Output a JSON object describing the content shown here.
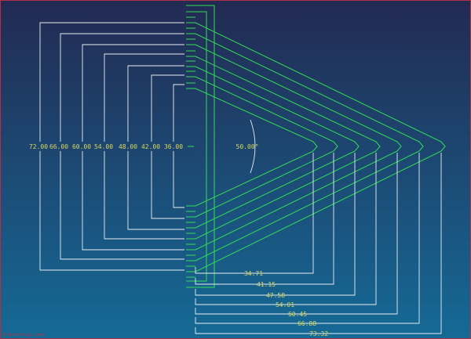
{
  "viewport": {
    "status_text": "Intersecting Lines",
    "colors": {
      "background_top": "#222a52",
      "background_bottom": "#156a96",
      "border": "#b0304a",
      "chevron_stroke": "#33dd55",
      "dimension_stroke": "#e8eef3",
      "dimension_text": "#d8d860",
      "status_text": "#c0303a"
    }
  },
  "drawing": {
    "angle_label": "50.00°",
    "offset_labels": [
      "72.00",
      "66.00",
      "60.00",
      "54.00",
      "48.00",
      "42.00",
      "36.00"
    ],
    "length_labels": [
      "34.71",
      "41.15",
      "47.58",
      "54.01",
      "60.45",
      "66.88",
      "73.32"
    ]
  }
}
